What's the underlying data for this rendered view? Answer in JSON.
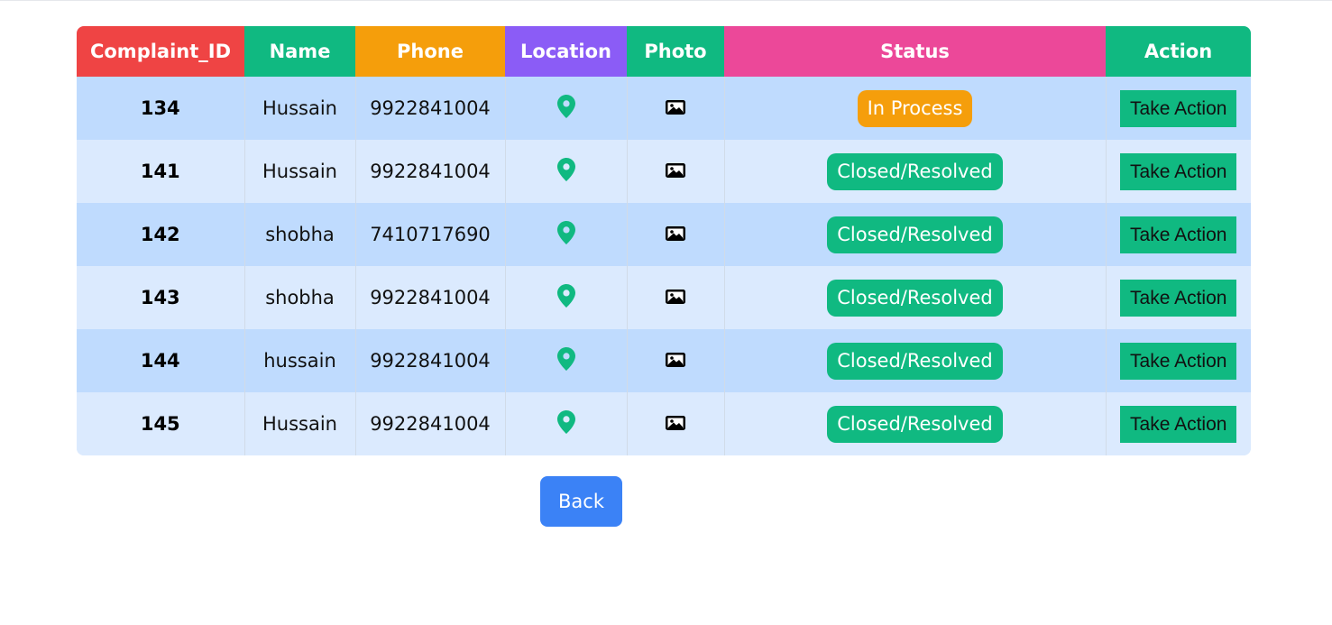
{
  "table": {
    "headers": [
      {
        "label": "Complaint_ID",
        "color": "#ef4444"
      },
      {
        "label": "Name",
        "color": "#10b981"
      },
      {
        "label": "Phone",
        "color": "#f59e0b"
      },
      {
        "label": "Location",
        "color": "#8b5cf6"
      },
      {
        "label": "Photo",
        "color": "#10b981"
      },
      {
        "label": "Status",
        "color": "#ec4899"
      },
      {
        "label": "Action",
        "color": "#10b981"
      }
    ],
    "rows": [
      {
        "id": "134",
        "name": "Hussain",
        "phone": "9922841004",
        "status": "In Process",
        "status_color": "#f59e0b",
        "action": "Take Action"
      },
      {
        "id": "141",
        "name": "Hussain",
        "phone": "9922841004",
        "status": "Closed/Resolved",
        "status_color": "#10b981",
        "action": "Take Action"
      },
      {
        "id": "142",
        "name": "shobha",
        "phone": "7410717690",
        "status": "Closed/Resolved",
        "status_color": "#10b981",
        "action": "Take Action"
      },
      {
        "id": "143",
        "name": "shobha",
        "phone": "9922841004",
        "status": "Closed/Resolved",
        "status_color": "#10b981",
        "action": "Take Action"
      },
      {
        "id": "144",
        "name": "hussain",
        "phone": "9922841004",
        "status": "Closed/Resolved",
        "status_color": "#10b981",
        "action": "Take Action"
      },
      {
        "id": "145",
        "name": "Hussain",
        "phone": "9922841004",
        "status": "Closed/Resolved",
        "status_color": "#10b981",
        "action": "Take Action"
      }
    ],
    "location_icon": "map-pin-icon",
    "photo_icon": "image-icon",
    "action_color": "#10b981"
  },
  "back_button": {
    "label": "Back",
    "color": "#3b82f6"
  }
}
